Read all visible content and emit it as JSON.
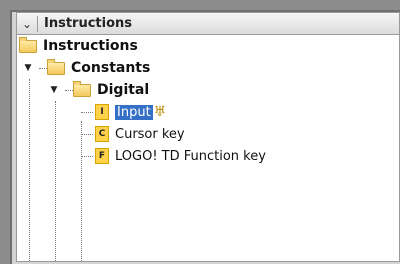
{
  "header": {
    "title": "Instructions"
  },
  "tree": {
    "root_label": "Instructions",
    "constants_label": "Constants",
    "digital_label": "Digital",
    "items": [
      {
        "badge": "I",
        "label": "Input"
      },
      {
        "badge": "C",
        "label": "Cursor key"
      },
      {
        "badge": "F",
        "label": "LOGO! TD Function key"
      }
    ]
  }
}
